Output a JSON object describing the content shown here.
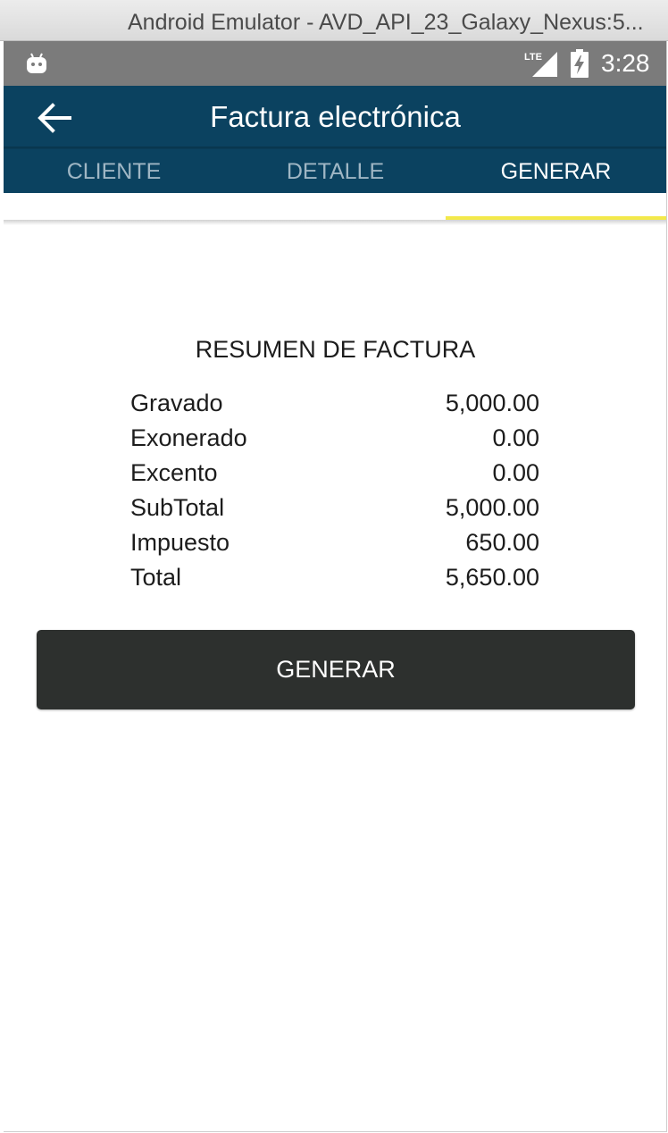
{
  "window": {
    "title": "Android Emulator - AVD_API_23_Galaxy_Nexus:5..."
  },
  "statusbar": {
    "time": "3:28",
    "network_label": "LTE",
    "icons": [
      "android-icon",
      "lte-signal-icon",
      "battery-charging-icon"
    ]
  },
  "appbar": {
    "title": "Factura electrónica",
    "back_icon": "arrow-left-icon"
  },
  "tabs": [
    {
      "label": "CLIENTE",
      "active": false
    },
    {
      "label": "DETALLE",
      "active": false
    },
    {
      "label": "GENERAR",
      "active": true
    }
  ],
  "summary": {
    "title": "RESUMEN DE FACTURA",
    "rows": [
      {
        "label": "Gravado",
        "value": "5,000.00"
      },
      {
        "label": "Exonerado",
        "value": "0.00"
      },
      {
        "label": "Excento",
        "value": "0.00"
      },
      {
        "label": "SubTotal",
        "value": "5,000.00"
      },
      {
        "label": "Impuesto",
        "value": "650.00"
      },
      {
        "label": "Total",
        "value": "5,650.00"
      }
    ]
  },
  "actions": {
    "generate_label": "GENERAR"
  },
  "colors": {
    "appbar": "#0b4260",
    "tab_indicator": "#f3e94a",
    "statusbar": "#7b7b7b",
    "button": "#2d302e"
  }
}
